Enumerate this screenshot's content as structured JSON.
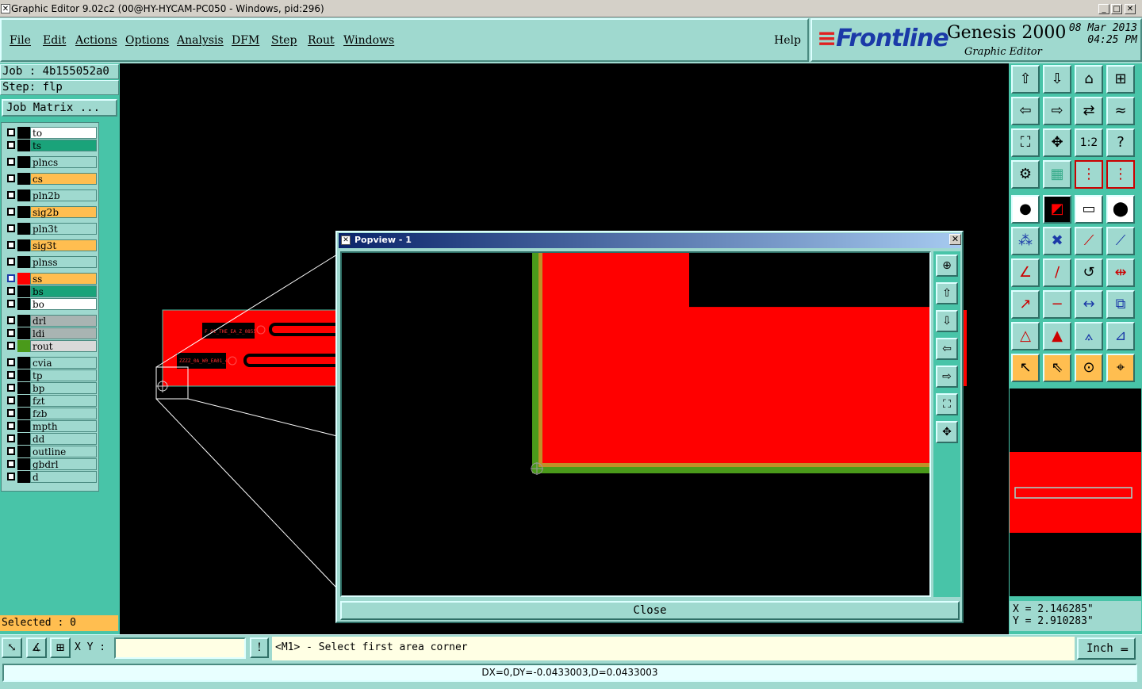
{
  "window": {
    "title": "Graphic Editor 9.02c2 (00@HY-HYCAM-PC050 - Windows, pid:296)",
    "icon": "x-icon"
  },
  "menu": {
    "items": [
      "File",
      "Edit",
      "Actions",
      "Options",
      "Analysis",
      "DFM",
      "Step",
      "Rout",
      "Windows"
    ],
    "help": "Help"
  },
  "brand": {
    "logo": "Frontline",
    "product": "Genesis 2000",
    "subtitle": "Graphic Editor",
    "date": "08 Mar 2013",
    "time": "04:25 PM"
  },
  "job": {
    "job_label": "Job : 4b155052a0",
    "step_label": "Step: flp",
    "matrix_button": "Job Matrix ..."
  },
  "layers": [
    {
      "name": "to",
      "color": "#ffffff"
    },
    {
      "name": "ts",
      "color": "#1aa37a"
    },
    {
      "name": "plncs",
      "color": "#9fd9cf"
    },
    {
      "name": "cs",
      "color": "#ffbe50"
    },
    {
      "name": "pln2b",
      "color": "#9fd9cf"
    },
    {
      "name": "sig2b",
      "color": "#ffbe50"
    },
    {
      "name": "pln3t",
      "color": "#9fd9cf"
    },
    {
      "name": "sig3t",
      "color": "#ffbe50"
    },
    {
      "name": "plnss",
      "color": "#9fd9cf"
    },
    {
      "name": "ss",
      "color": "#ffbe50",
      "active": true
    },
    {
      "name": "bs",
      "color": "#1aa37a"
    },
    {
      "name": "bo",
      "color": "#ffffff"
    },
    {
      "name": "drl",
      "color": "#a9b4b2"
    },
    {
      "name": "ldi",
      "color": "#a9b4b2"
    },
    {
      "name": "rout",
      "color": "#d9d9d9",
      "active_color": "#4a9a1a"
    },
    {
      "name": "cvia",
      "color": "#9fd9cf"
    },
    {
      "name": "tp",
      "color": "#9fd9cf"
    },
    {
      "name": "bp",
      "color": "#9fd9cf"
    },
    {
      "name": "fzt",
      "color": "#9fd9cf"
    },
    {
      "name": "fzb",
      "color": "#9fd9cf"
    },
    {
      "name": "mpth",
      "color": "#9fd9cf"
    },
    {
      "name": "dd",
      "color": "#9fd9cf"
    },
    {
      "name": "outline",
      "color": "#9fd9cf"
    },
    {
      "name": "gbdrl",
      "color": "#9fd9cf"
    },
    {
      "name": "d",
      "color": "#9fd9cf"
    }
  ],
  "selected": "Selected : 0",
  "canvas": {
    "board_color": "#ff0000",
    "labels": [
      "F_01_THE_EA_Z_0855",
      "ZZZZ_0A_W0_EA01_4"
    ]
  },
  "popview": {
    "title": "Popview - 1",
    "close_label": "Close",
    "close_icon": "close-icon"
  },
  "coords": {
    "x": "X = 2.146285\"",
    "y": "Y = 2.910283\""
  },
  "bottom": {
    "xy_label": "X Y :",
    "xy_value": "",
    "prompt": "<M1> - Select first area corner",
    "unit": "Inch",
    "unit_icon": "dash-icon"
  },
  "status": "DX=0,DY=-0.0433003,D=0.0433003",
  "colors": {
    "panel": "#9fd9cf",
    "panel_dark": "#48c4a8",
    "highlight": "#ffbe50",
    "copper": "#ff0000",
    "rout": "#4a9a1a"
  }
}
